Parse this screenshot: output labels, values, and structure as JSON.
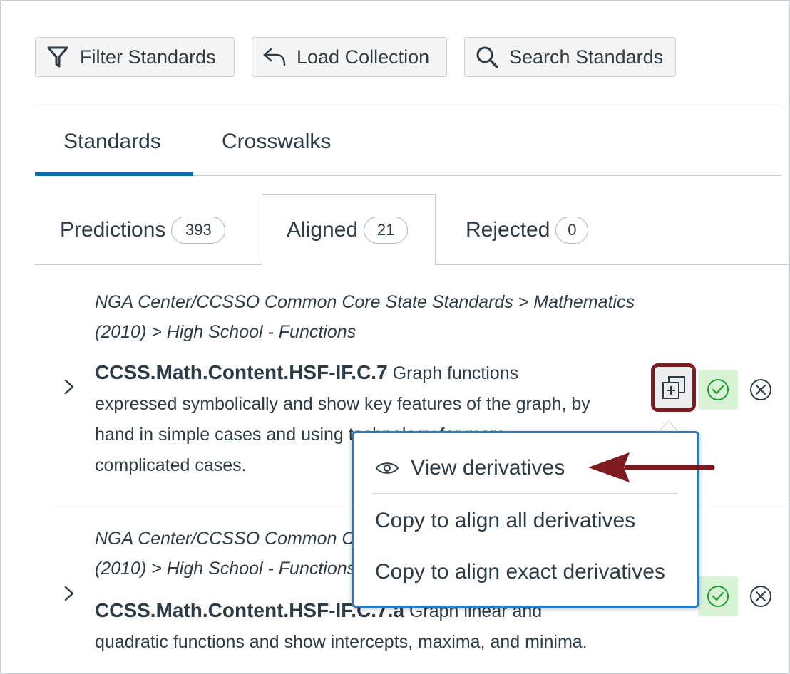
{
  "toolbar": {
    "filter_label": "Filter Standards",
    "load_label": "Load Collection",
    "search_label": "Search Standards"
  },
  "main_tabs": [
    {
      "label": "Standards",
      "selected": true
    },
    {
      "label": "Crosswalks",
      "selected": false
    }
  ],
  "sub_tabs": [
    {
      "label": "Predictions",
      "count": "393"
    },
    {
      "label": "Aligned",
      "count": "21",
      "selected": true
    },
    {
      "label": "Rejected",
      "count": "0"
    }
  ],
  "rows": [
    {
      "path_line1": "NGA Center/CCSSO Common Core State Standards > Mathematics",
      "path_line2": "(2010) > High School - Functions",
      "code": "CCSS.Math.Content.HSF-IF.C.7",
      "desc_first": "Graph functions",
      "desc_line2": "expressed symbolically and show key features of the graph, by",
      "desc_line3": "hand in simple cases and using technology for more",
      "desc_line4": "complicated cases."
    },
    {
      "path_line1": "NGA Center/CCSSO Common Core State Standards > Mathematics",
      "path_line2": "(2010) > High School - Functions",
      "code": "CCSS.Math.Content.HSF-IF.C.7.a",
      "desc_first": "Graph linear and",
      "desc_line2": "quadratic functions and show intercepts, maxima, and minima."
    }
  ],
  "menu": {
    "items": [
      {
        "label": "View derivatives",
        "icon": "eye-icon"
      },
      {
        "label": "Copy to align all derivatives"
      },
      {
        "label": "Copy to align exact derivatives"
      }
    ]
  },
  "colors": {
    "accent": "#0770a3",
    "highlight": "#7d1a1f",
    "menu_border": "#2b7abc",
    "success_bg": "#d9f2d6",
    "success": "#1f9e2f"
  }
}
